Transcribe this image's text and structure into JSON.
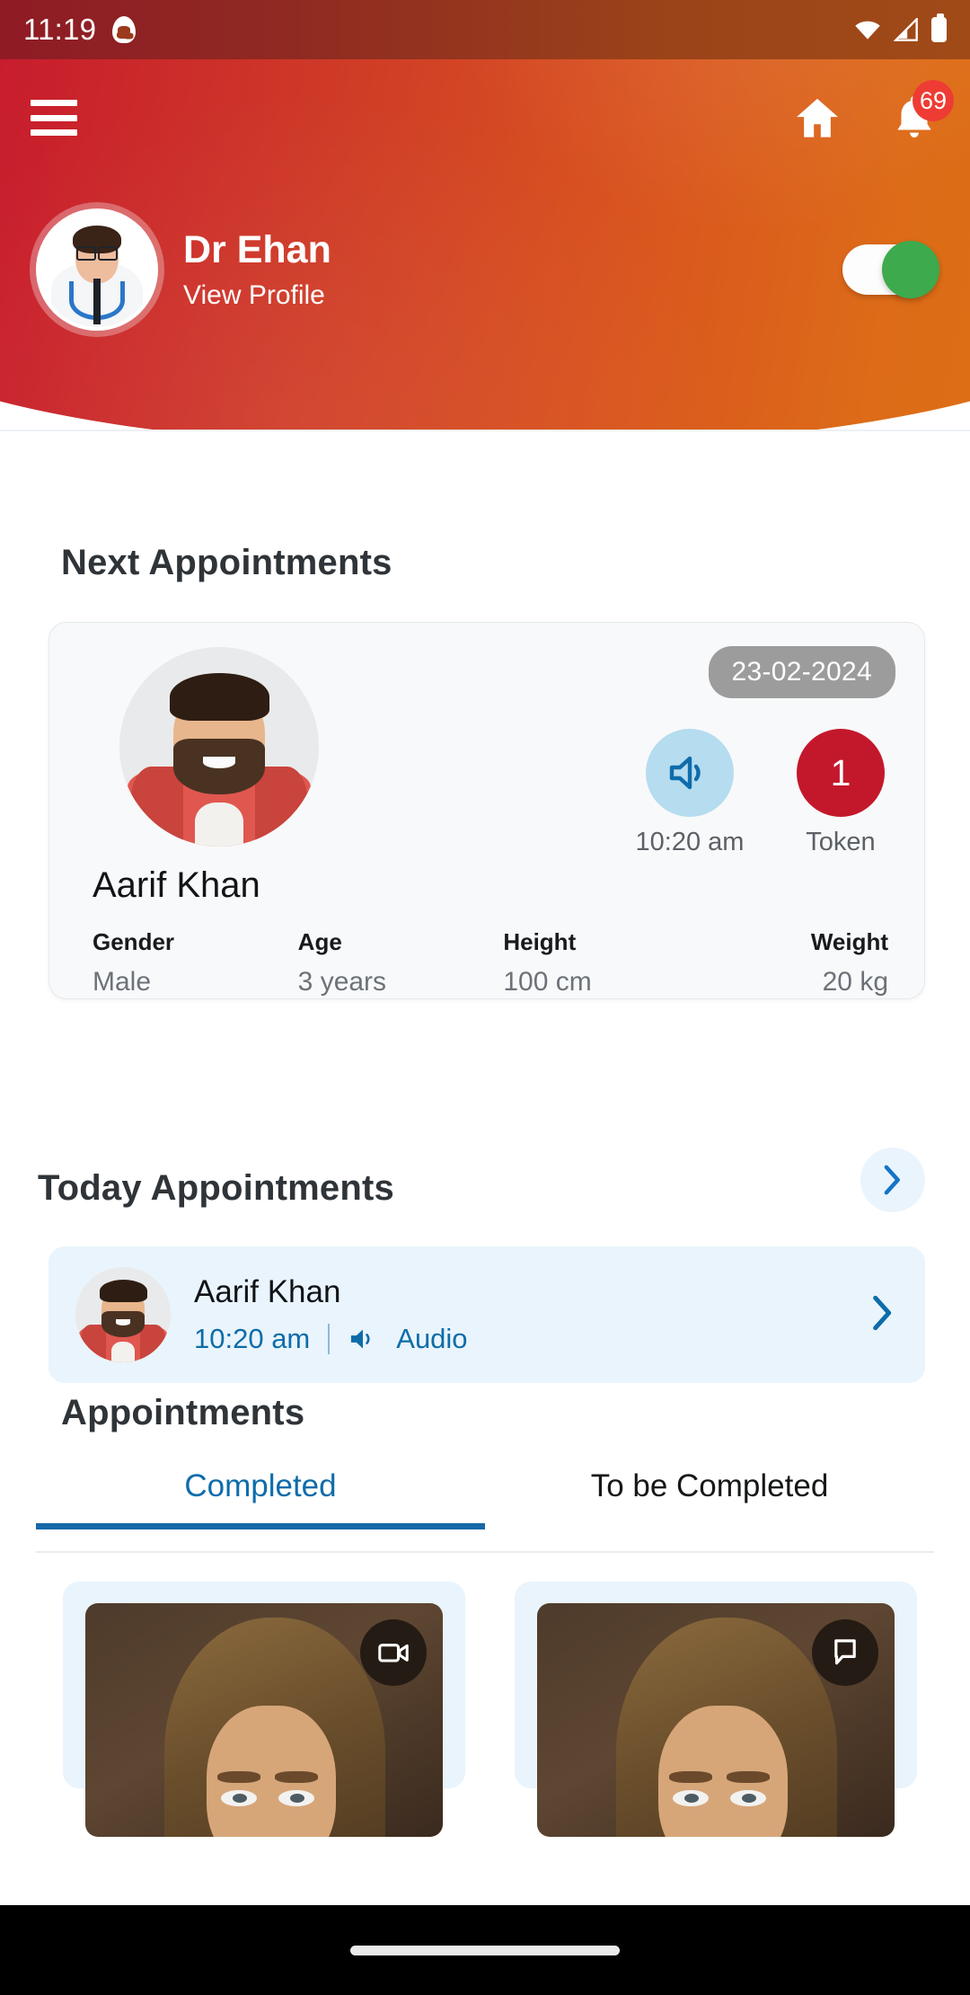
{
  "status_bar": {
    "time": "11:19",
    "icons": [
      "ghost-notification-icon",
      "wifi-icon",
      "cellular-signal-icon",
      "battery-icon"
    ]
  },
  "header": {
    "menu_icon": "hamburger-menu-icon",
    "home_icon": "home-icon",
    "notification_icon": "bell-icon",
    "notification_count": "69",
    "doctor_name": "Dr Ehan",
    "view_profile_label": "View Profile",
    "availability_toggle": "on",
    "gradient_start": "#c41230",
    "gradient_end": "#de7014",
    "toggle_on_color": "#3caa4d",
    "badge_color": "#ee3c34"
  },
  "next_appointments": {
    "title": "Next Appointments",
    "card": {
      "date": "23-02-2024",
      "consult_mode_icon": "speaker-audio-icon",
      "time": "10:20 am",
      "token_number": "1",
      "token_label": "Token",
      "patient_name": "Aarif Khan",
      "stats": [
        {
          "key": "Gender",
          "value": "Male"
        },
        {
          "key": "Age",
          "value": "3 years"
        },
        {
          "key": "Height",
          "value": "100 cm"
        },
        {
          "key": "Weight",
          "value": "20 kg"
        }
      ],
      "token_color": "#c3182c",
      "audio_circle_color": "#b5dcef",
      "date_pill_color": "#9c9c9c"
    }
  },
  "today_appointments": {
    "title": "Today Appointments",
    "see_all_icon": "chevron-right-icon",
    "items": [
      {
        "name": "Aarif Khan",
        "time": "10:20 am",
        "mode_icon": "speaker-audio-icon",
        "mode": "Audio",
        "chevron_icon": "chevron-right-icon"
      }
    ],
    "card_bg": "#e9f4fc",
    "accent": "#0d6ca8"
  },
  "appointments": {
    "title": "Appointments",
    "tabs": [
      {
        "label": "Completed",
        "active": true
      },
      {
        "label": "To be Completed",
        "active": false
      }
    ],
    "active_color": "#0f6cab",
    "cards": [
      {
        "badge_icon": "video-camera-icon"
      },
      {
        "badge_icon": "chat-bubble-icon"
      }
    ]
  },
  "nav_bar": {
    "home_indicator": "home-pill-indicator"
  }
}
